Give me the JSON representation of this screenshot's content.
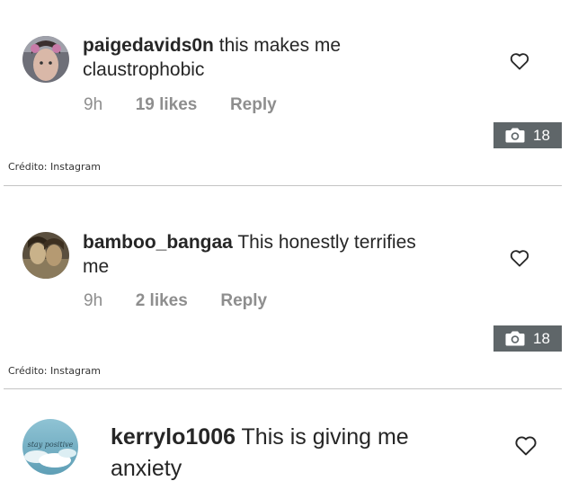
{
  "comments": [
    {
      "username": "paigedavids0n",
      "text": "this makes me",
      "text2": "claustrophobic",
      "time": "9h",
      "likes": "19 likes",
      "reply": "Reply",
      "avatar_icon": "profile-photo-icon",
      "like_icon": "heart-outline-icon"
    },
    {
      "username": "bamboo_bangaa",
      "text": "This honestly terrifies",
      "text2": "me",
      "time": "9h",
      "likes": "2 likes",
      "reply": "Reply",
      "avatar_icon": "profile-photo-icon",
      "like_icon": "heart-outline-icon"
    },
    {
      "username": "kerrylo1006",
      "text": "This is giving me",
      "text2": "anxiety",
      "avatar_text": "stay positive",
      "avatar_icon": "profile-photo-icon",
      "like_icon": "heart-outline-icon"
    }
  ],
  "gallery_badges": [
    {
      "count": "18",
      "icon": "camera-icon"
    },
    {
      "count": "18",
      "icon": "camera-icon"
    }
  ],
  "credits": [
    {
      "text": "Crédito: Instagram"
    },
    {
      "text": "Crédito: Instagram"
    }
  ],
  "colors": {
    "text": "#262626",
    "meta": "#8e8e8e",
    "badge_bg": "#5f6669",
    "divider": "#c4c4c4"
  }
}
